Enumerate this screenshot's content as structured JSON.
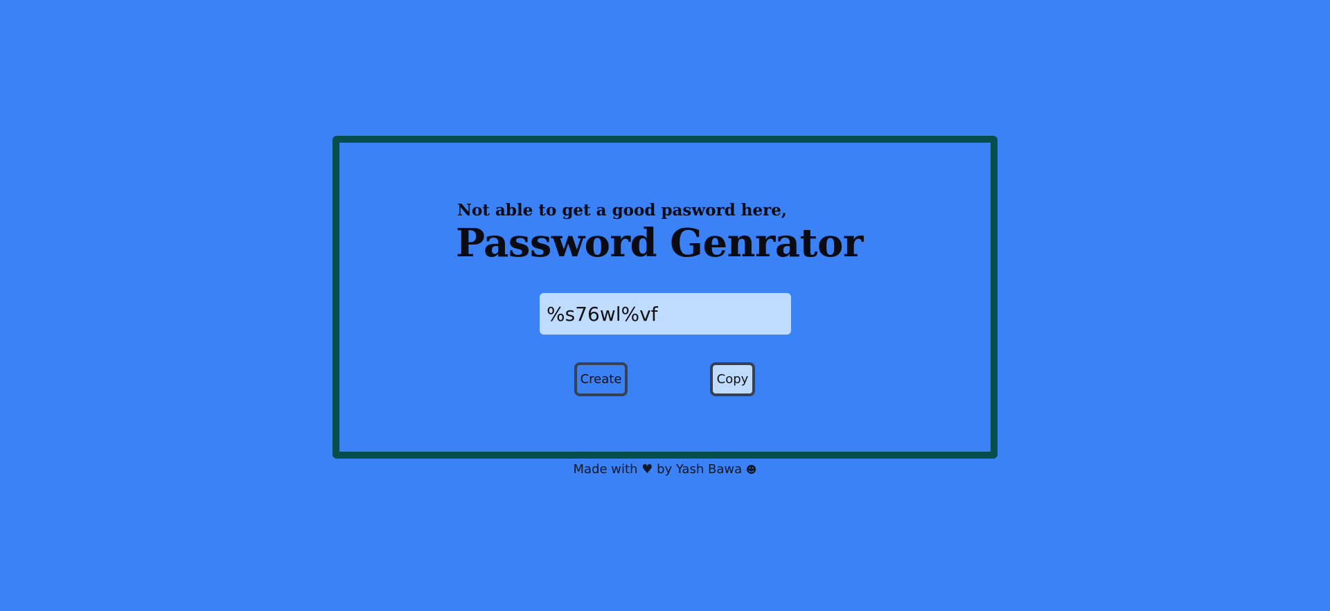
{
  "header": {
    "subtitle": "Not able to get a good pasword here,",
    "title": "Password Genrator"
  },
  "password": {
    "value": "%s76wl%vf"
  },
  "buttons": {
    "create_label": "Create",
    "copy_label": "Copy"
  },
  "footer": {
    "made_with": "Made with",
    "heart_icon": "♥",
    "by_text": "by Yash Bawa",
    "smiley_icon": "☻"
  },
  "colors": {
    "background": "#3b82f6",
    "card_border": "#064e4b",
    "input_background": "#bfdbfe",
    "button_border": "#374151"
  }
}
